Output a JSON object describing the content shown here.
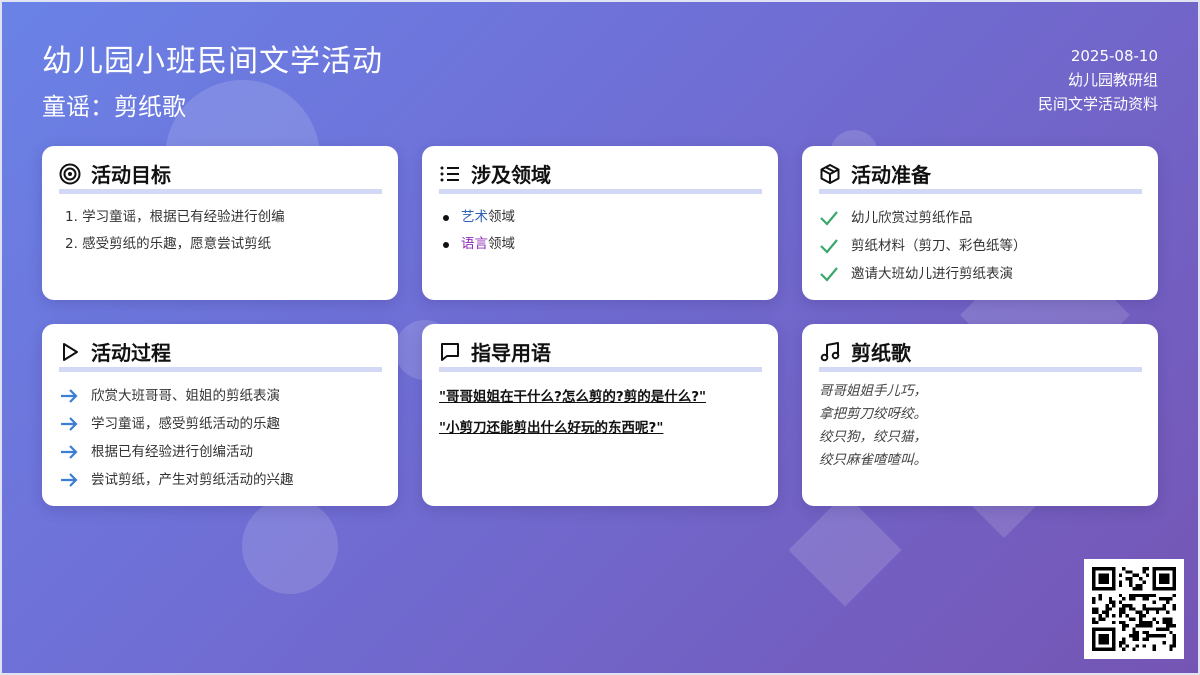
{
  "header": {
    "title": "幼儿园小班民间文学活动",
    "subtitle": "童谣：剪纸歌",
    "date": "2025-08-10",
    "org": "幼儿园教研组",
    "doc_type": "民间文学活动资料"
  },
  "cards": {
    "goals": {
      "title": "活动目标",
      "icon": "target-icon",
      "items": [
        "1. 学习童谣，根据已有经验进行创编",
        "2. 感受剪纸的乐趣，愿意尝试剪纸"
      ]
    },
    "domains": {
      "title": "涉及领域",
      "icon": "list-icon",
      "items": [
        {
          "keyword": "艺术",
          "suffix": "领域",
          "color": "#2f5fb8"
        },
        {
          "keyword": "语言",
          "suffix": "领域",
          "color": "#8e2fb8"
        }
      ]
    },
    "prep": {
      "title": "活动准备",
      "icon": "box-icon",
      "items": [
        "幼儿欣赏过剪纸作品",
        "剪纸材料（剪刀、彩色纸等）",
        "邀请大班幼儿进行剪纸表演"
      ],
      "check_color": "#3aa76d"
    },
    "process": {
      "title": "活动过程",
      "icon": "play-icon",
      "items": [
        "欣赏大班哥哥、姐姐的剪纸表演",
        "学习童谣，感受剪纸活动的乐趣",
        "根据已有经验进行创编活动",
        "尝试剪纸，产生对剪纸活动的兴趣"
      ],
      "arrow_color": "#3b7fd4"
    },
    "guide": {
      "title": "指导用语",
      "icon": "chat-icon",
      "quotes": [
        "\"哥哥姐姐在干什么?怎么剪的?剪的是什么?\"",
        "\"小剪刀还能剪出什么好玩的东西呢?\""
      ]
    },
    "song": {
      "title": "剪纸歌",
      "icon": "music-icon",
      "lines": [
        "哥哥姐姐手儿巧，",
        "拿把剪刀绞呀绞。",
        "绞只狗，绞只猫，",
        "绞只麻雀喳喳叫。"
      ]
    }
  },
  "colors": {
    "accent_underline": "#d3d8f5",
    "bg_start": "#6a82e6",
    "bg_end": "#7555b4"
  }
}
